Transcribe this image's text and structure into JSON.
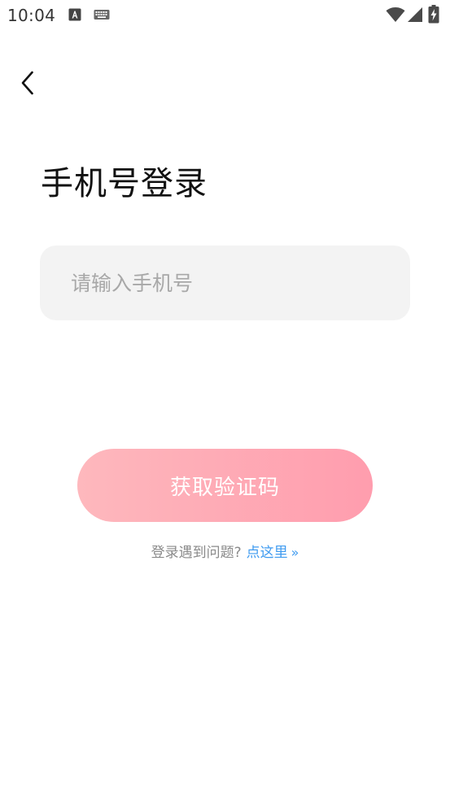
{
  "status_bar": {
    "time": "10:04"
  },
  "nav": {
    "back_icon": "chevron-left-icon"
  },
  "login": {
    "title": "手机号登录",
    "phone_placeholder": "请输入手机号",
    "phone_value": "",
    "get_code_label": "获取验证码",
    "help_text": "登录遇到问题?",
    "help_link": "点这里",
    "help_arrow": "»"
  },
  "colors": {
    "button_gradient_start": "#feb8bd",
    "button_gradient_end": "#ff9dae",
    "link": "#3f9bf0",
    "input_bg": "#f3f3f3",
    "placeholder": "#a8a8a8"
  }
}
